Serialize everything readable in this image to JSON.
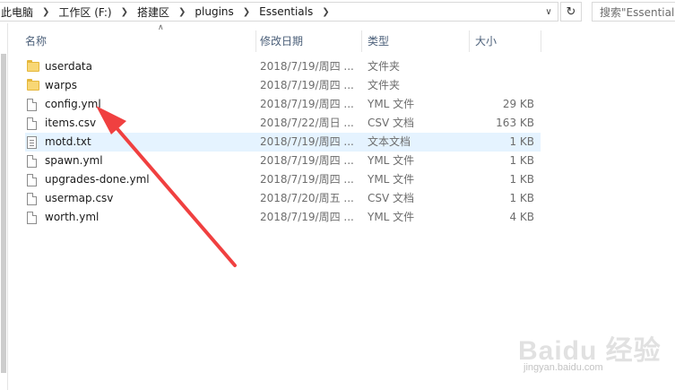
{
  "breadcrumb": {
    "items": [
      "此电脑",
      "工作区 (F:)",
      "搭建区",
      "plugins",
      "Essentials"
    ]
  },
  "search": {
    "placeholder": "搜索\"Essentials\""
  },
  "columns": {
    "name": "名称",
    "date": "修改日期",
    "type": "类型",
    "size": "大小"
  },
  "files": [
    {
      "icon": "folder-icon",
      "name": "userdata",
      "date": "2018/7/19/周四 ...",
      "type": "文件夹",
      "size": ""
    },
    {
      "icon": "folder-icon",
      "name": "warps",
      "date": "2018/7/19/周四 ...",
      "type": "文件夹",
      "size": ""
    },
    {
      "icon": "file-icon",
      "name": "config.yml",
      "date": "2018/7/19/周四 ...",
      "type": "YML 文件",
      "size": "29 KB"
    },
    {
      "icon": "file-icon",
      "name": "items.csv",
      "date": "2018/7/22/周日 ...",
      "type": "CSV 文档",
      "size": "163 KB"
    },
    {
      "icon": "text-file-icon",
      "name": "motd.txt",
      "date": "2018/7/19/周四 ...",
      "type": "文本文档",
      "size": "1 KB"
    },
    {
      "icon": "file-icon",
      "name": "spawn.yml",
      "date": "2018/7/19/周四 ...",
      "type": "YML 文件",
      "size": "1 KB"
    },
    {
      "icon": "file-icon",
      "name": "upgrades-done.yml",
      "date": "2018/7/19/周四 ...",
      "type": "YML 文件",
      "size": "1 KB"
    },
    {
      "icon": "file-icon",
      "name": "usermap.csv",
      "date": "2018/7/20/周五 ...",
      "type": "CSV 文档",
      "size": "1 KB"
    },
    {
      "icon": "file-icon",
      "name": "worth.yml",
      "date": "2018/7/19/周四 ...",
      "type": "YML 文件",
      "size": "4 KB"
    }
  ],
  "selected_index": 4,
  "watermark": {
    "logo": "Baidu 经验",
    "sub": "jingyan.baidu.com"
  },
  "colors": {
    "annotation_arrow": "#f04040",
    "selection": "#e5f3ff",
    "header_text": "#4c607a"
  }
}
